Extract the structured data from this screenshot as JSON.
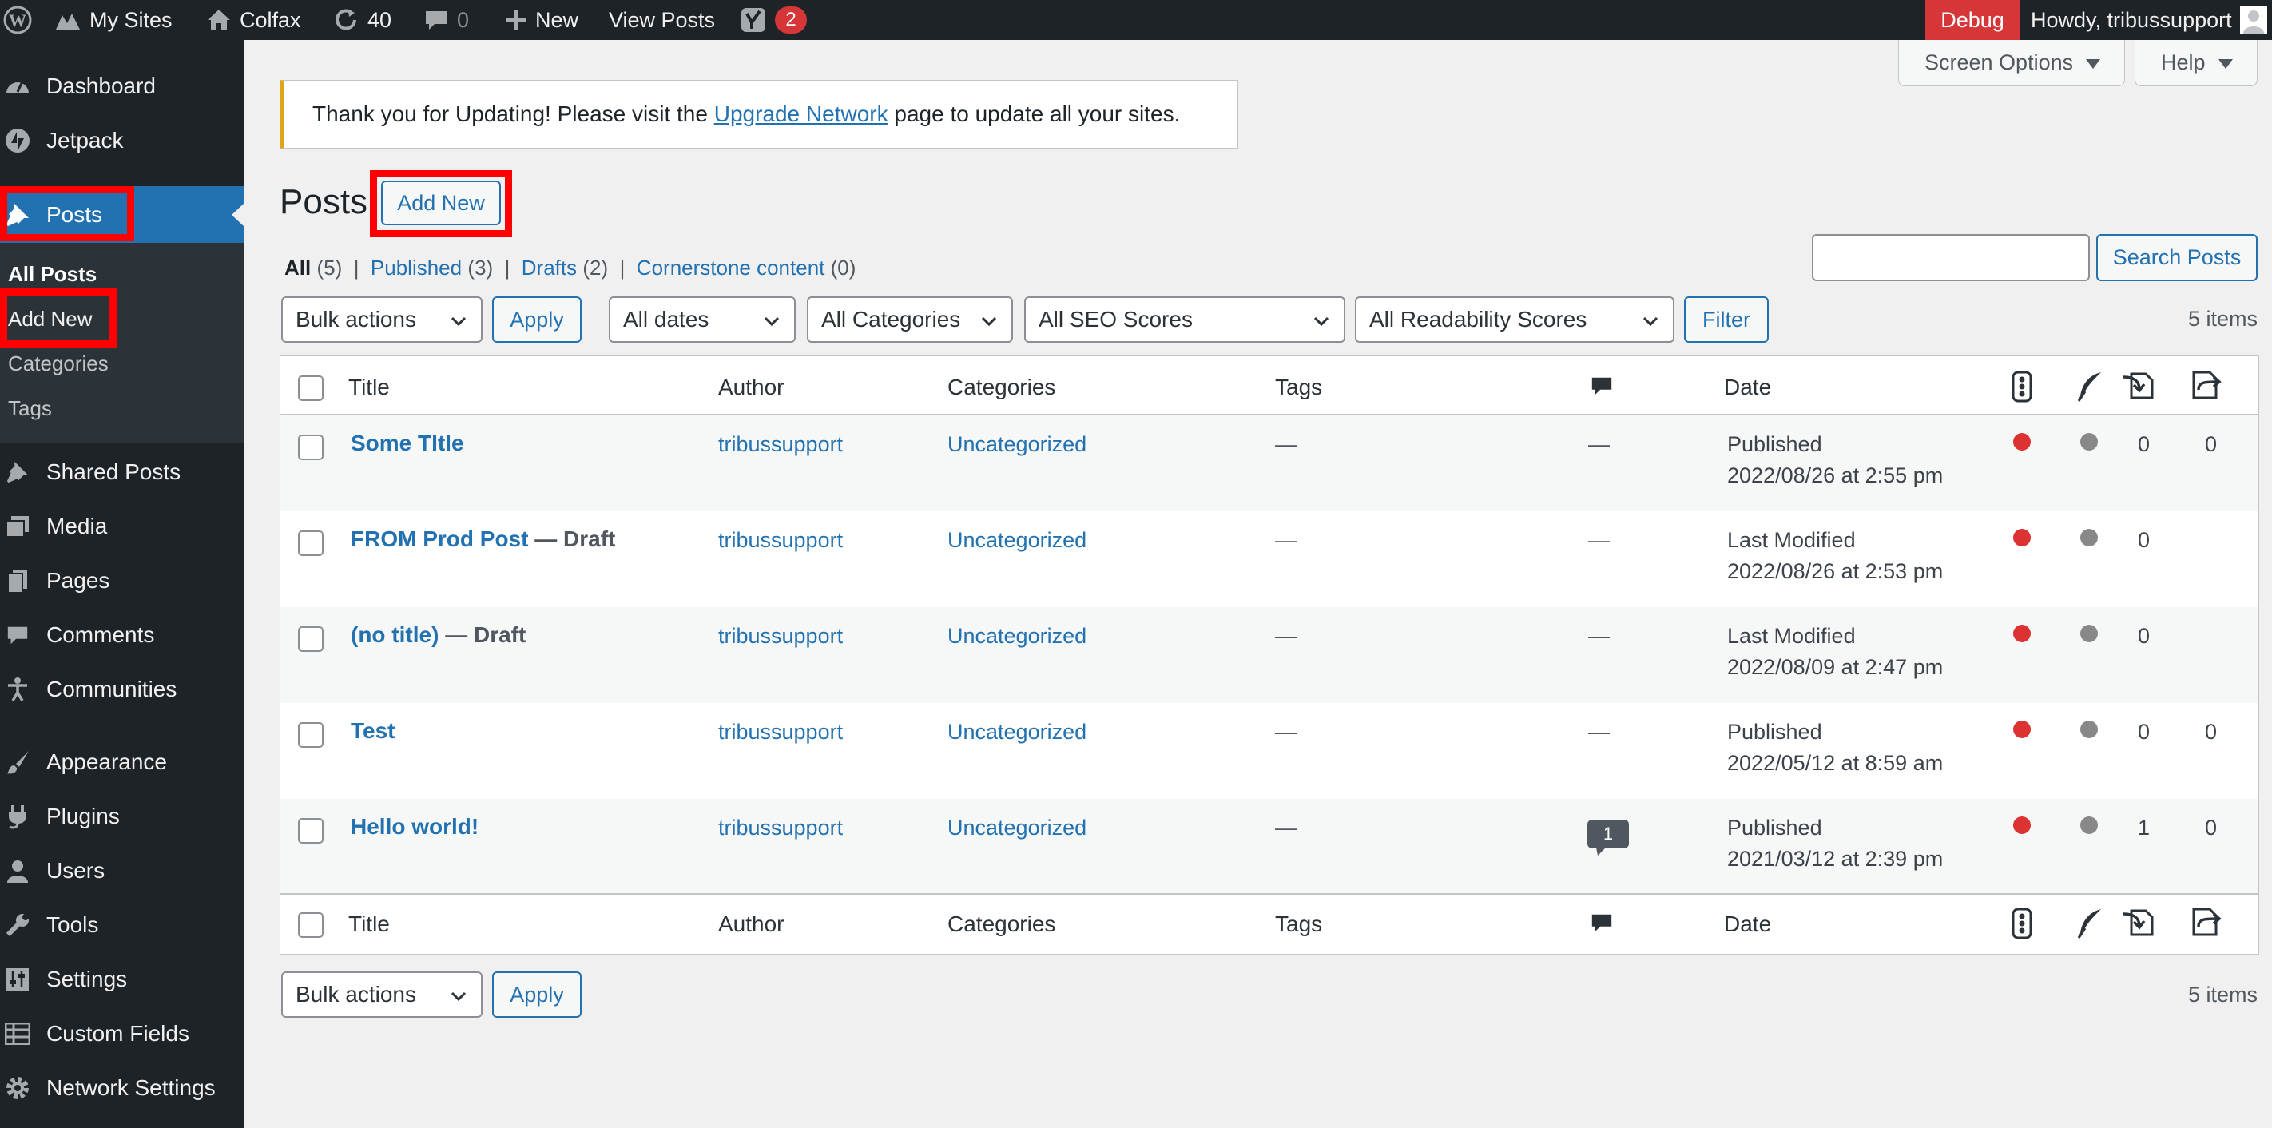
{
  "admin_bar": {
    "my_sites": "My Sites",
    "site": "Colfax",
    "updates": "40",
    "comments": "0",
    "new": "New",
    "view_posts": "View Posts",
    "yoast_count": "2",
    "debug": "Debug",
    "howdy": "Howdy, tribussupport"
  },
  "sidebar": {
    "dashboard": "Dashboard",
    "jetpack": "Jetpack",
    "posts": "Posts",
    "sub": {
      "all_posts": "All Posts",
      "add_new": "Add New",
      "categories": "Categories",
      "tags": "Tags"
    },
    "shared_posts": "Shared Posts",
    "media": "Media",
    "pages": "Pages",
    "comments": "Comments",
    "communities": "Communities",
    "appearance": "Appearance",
    "plugins": "Plugins",
    "users": "Users",
    "tools": "Tools",
    "settings": "Settings",
    "custom_fields": "Custom Fields",
    "network_settings": "Network Settings"
  },
  "screen_options": "Screen Options",
  "help": "Help",
  "notice": {
    "before": "Thank you for Updating! Please visit the ",
    "link": "Upgrade Network",
    "after": " page to update all your sites."
  },
  "page_title": "Posts",
  "add_new": "Add New",
  "search_button": "Search Posts",
  "search_value": "",
  "views": {
    "all": "All",
    "all_count": "(5)",
    "published": "Published",
    "published_count": "(3)",
    "drafts": "Drafts",
    "drafts_count": "(2)",
    "cornerstone": "Cornerstone content",
    "cornerstone_count": "(0)"
  },
  "filters": {
    "bulk_actions": "Bulk actions",
    "apply": "Apply",
    "dates": "All dates",
    "categories": "All Categories",
    "seo": "All SEO Scores",
    "readability": "All Readability Scores",
    "filter": "Filter",
    "items": "5 items"
  },
  "columns": {
    "title": "Title",
    "author": "Author",
    "categories": "Categories",
    "tags": "Tags",
    "date": "Date"
  },
  "rows": [
    {
      "title": "Some TItle",
      "state": "",
      "author": "tribussupport",
      "category": "Uncategorized",
      "tags": "—",
      "comments": "—",
      "status": "Published",
      "date": "2022/08/26 at 2:55 pm",
      "links_in": "0",
      "links_out": "0"
    },
    {
      "title": "FROM Prod Post",
      "state": " — Draft",
      "author": "tribussupport",
      "category": "Uncategorized",
      "tags": "—",
      "comments": "—",
      "status": "Last Modified",
      "date": "2022/08/26 at 2:53 pm",
      "links_in": "0",
      "links_out": ""
    },
    {
      "title": "(no title)",
      "state": " — Draft",
      "author": "tribussupport",
      "category": "Uncategorized",
      "tags": "—",
      "comments": "—",
      "status": "Last Modified",
      "date": "2022/08/09 at 2:47 pm",
      "links_in": "0",
      "links_out": ""
    },
    {
      "title": "Test",
      "state": "",
      "author": "tribussupport",
      "category": "Uncategorized",
      "tags": "—",
      "comments": "—",
      "status": "Published",
      "date": "2022/05/12 at 8:59 am",
      "links_in": "0",
      "links_out": "0"
    },
    {
      "title": "Hello world!",
      "state": "",
      "author": "tribussupport",
      "category": "Uncategorized",
      "tags": "—",
      "comments": "1",
      "status": "Published",
      "date": "2021/03/12 at 2:39 pm",
      "links_in": "1",
      "links_out": "0"
    }
  ],
  "colors": {
    "seo_bad": "#dc3232",
    "readability_na": "#888888",
    "link": "#2271b1",
    "menu_active": "#2271b1"
  }
}
